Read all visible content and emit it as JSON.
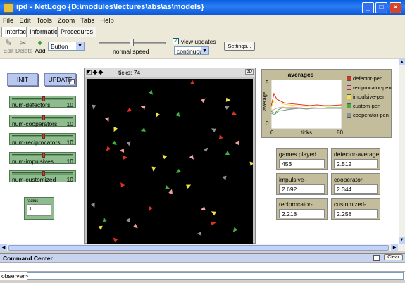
{
  "window": {
    "title": "ipd - NetLogo {D:\\modules\\lectures\\abs\\as\\models}"
  },
  "menu": [
    "File",
    "Edit",
    "Tools",
    "Zoom",
    "Tabs",
    "Help"
  ],
  "tabs": [
    "Interface",
    "Information",
    "Procedures"
  ],
  "toolbar": {
    "edit": "Edit",
    "delete": "Delete",
    "add": "Add",
    "widget_type": "Button",
    "speed_label": "normal speed",
    "view_updates": "view updates",
    "update_mode": "continuous",
    "settings": "Settings..."
  },
  "buttons": {
    "init": "INIT",
    "update": "UPDATE"
  },
  "sliders": [
    {
      "label": "num-defectors",
      "value": "10",
      "level": 0.5
    },
    {
      "label": "num-cooperators",
      "value": "10",
      "level": 0.5
    },
    {
      "label": "num-reciprocators",
      "value": "10",
      "level": 0.5
    },
    {
      "label": "num-impulsives",
      "value": "10",
      "level": 0.5
    },
    {
      "label": "num-customized",
      "value": "10",
      "level": 0.5
    }
  ],
  "radius": {
    "label": "radius",
    "value": "1"
  },
  "view": {
    "ticks": "ticks: 74",
    "three_d": "3D"
  },
  "plot": {
    "title": "averages",
    "ylabel": "average",
    "xlabel": "ticks",
    "y_max": "5",
    "y_min": "0",
    "x_min": "0",
    "x_max": "80",
    "legend": [
      {
        "name": "defector-pen",
        "color": "#e03020"
      },
      {
        "name": "reciprocator-pen",
        "color": "#f0a0a0"
      },
      {
        "name": "impulsive-pen",
        "color": "#f0e040"
      },
      {
        "name": "custom-pen",
        "color": "#40b040"
      },
      {
        "name": "cooperator-pen",
        "color": "#909090"
      }
    ]
  },
  "monitors": [
    {
      "label": "games played",
      "value": "453"
    },
    {
      "label": "defector-average",
      "value": "2.512"
    },
    {
      "label": "impulsive-average",
      "value": "2.692"
    },
    {
      "label": "cooperator-average",
      "value": "2.344"
    },
    {
      "label": "reciprocator-average",
      "value": "2.218"
    },
    {
      "label": "customized-average",
      "value": "2.258"
    }
  ],
  "command_center": {
    "title": "Command Center",
    "clear": "Clear",
    "prompt": "observer>"
  }
}
